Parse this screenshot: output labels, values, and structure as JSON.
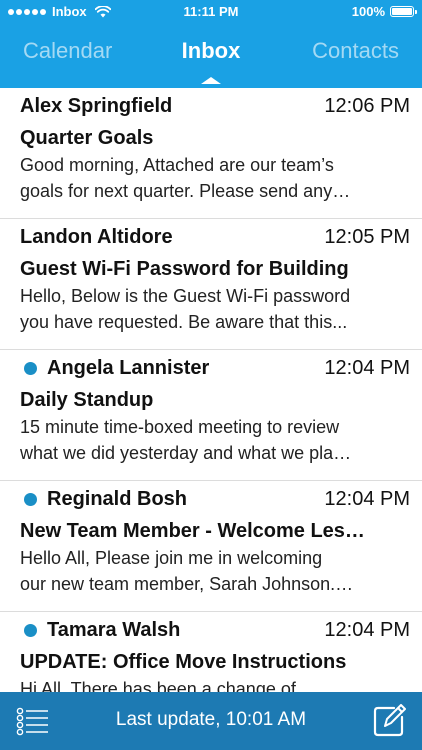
{
  "status_bar": {
    "carrier": "Inbox",
    "time": "11:11 PM",
    "battery": "100%"
  },
  "tabs": [
    {
      "label": "Calendar",
      "active": false
    },
    {
      "label": "Inbox",
      "active": true
    },
    {
      "label": "Contacts",
      "active": false
    }
  ],
  "messages": [
    {
      "sender": "Alex Springfield",
      "time": "12:06 PM",
      "unread": false,
      "subject": "Quarter Goals",
      "preview_line1": "Good morning, Attached are our team’s",
      "preview_line2": "goals for next quarter. Please send any…"
    },
    {
      "sender": "Landon Altidore",
      "time": "12:05 PM",
      "unread": false,
      "subject": "Guest Wi-Fi Password for Building",
      "preview_line1": "Hello, Below is the Guest Wi-Fi password",
      "preview_line2": "you have requested. Be aware that this..."
    },
    {
      "sender": "Angela Lannister",
      "time": "12:04 PM",
      "unread": true,
      "subject": "Daily Standup",
      "preview_line1": "15 minute time-boxed meeting to review",
      "preview_line2": "what we did yesterday and what we pla…"
    },
    {
      "sender": "Reginald Bosh",
      "time": "12:04 PM",
      "unread": true,
      "subject": "New Team Member - Welcome Les…",
      "preview_line1": "Hello All, Please join me in welcoming",
      "preview_line2": "our new team member, Sarah Johnson.…"
    },
    {
      "sender": "Tamara Walsh",
      "time": "12:04 PM",
      "unread": true,
      "subject": "UPDATE: Office Move Instructions",
      "preview_line1": "Hi All. There has been a change of",
      "preview_line2": ""
    }
  ],
  "footer": {
    "status_text": "Last update, 10:01 AM",
    "left_icon": "filter-list-icon",
    "right_icon": "compose-icon"
  },
  "colors": {
    "header_bg": "#1aa1e4",
    "footer_bg": "#1d7ab3",
    "unread_dot": "#1a8fc6"
  }
}
